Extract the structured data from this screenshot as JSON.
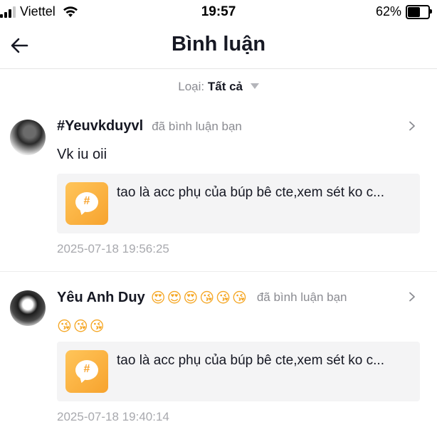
{
  "status_bar": {
    "carrier": "Viettel",
    "time": "19:57",
    "battery_percent": "62%",
    "battery_level": 0.62
  },
  "header": {
    "title": "Bình luận",
    "back_icon": "arrow-left-icon"
  },
  "filter": {
    "label": "Loại:",
    "value": "Tất cả",
    "icon": "caret-down-icon"
  },
  "comments": [
    {
      "username": "#Yeuvkduyvl",
      "action": "đã bình luận bạn",
      "text": "Vk iu oii",
      "card_text": "tao là acc phụ của búp bê cte,xem sét ko c...",
      "card_icon_text": "#",
      "timestamp": "2025-07-18 19:56:25"
    },
    {
      "username": "Yêu Anh Duy",
      "username_emoji": "😍😍😍😘😘😘",
      "action": "đã bình luận bạn",
      "text": "😘😘😘",
      "card_text": "tao là acc phụ của búp bê cte,xem sét ko c...",
      "card_icon_text": "#",
      "timestamp": "2025-07-18 19:40:14"
    }
  ],
  "colors": {
    "accent": "#f7a32e",
    "muted_text": "#8a8b91",
    "card_bg": "#f4f4f5"
  }
}
